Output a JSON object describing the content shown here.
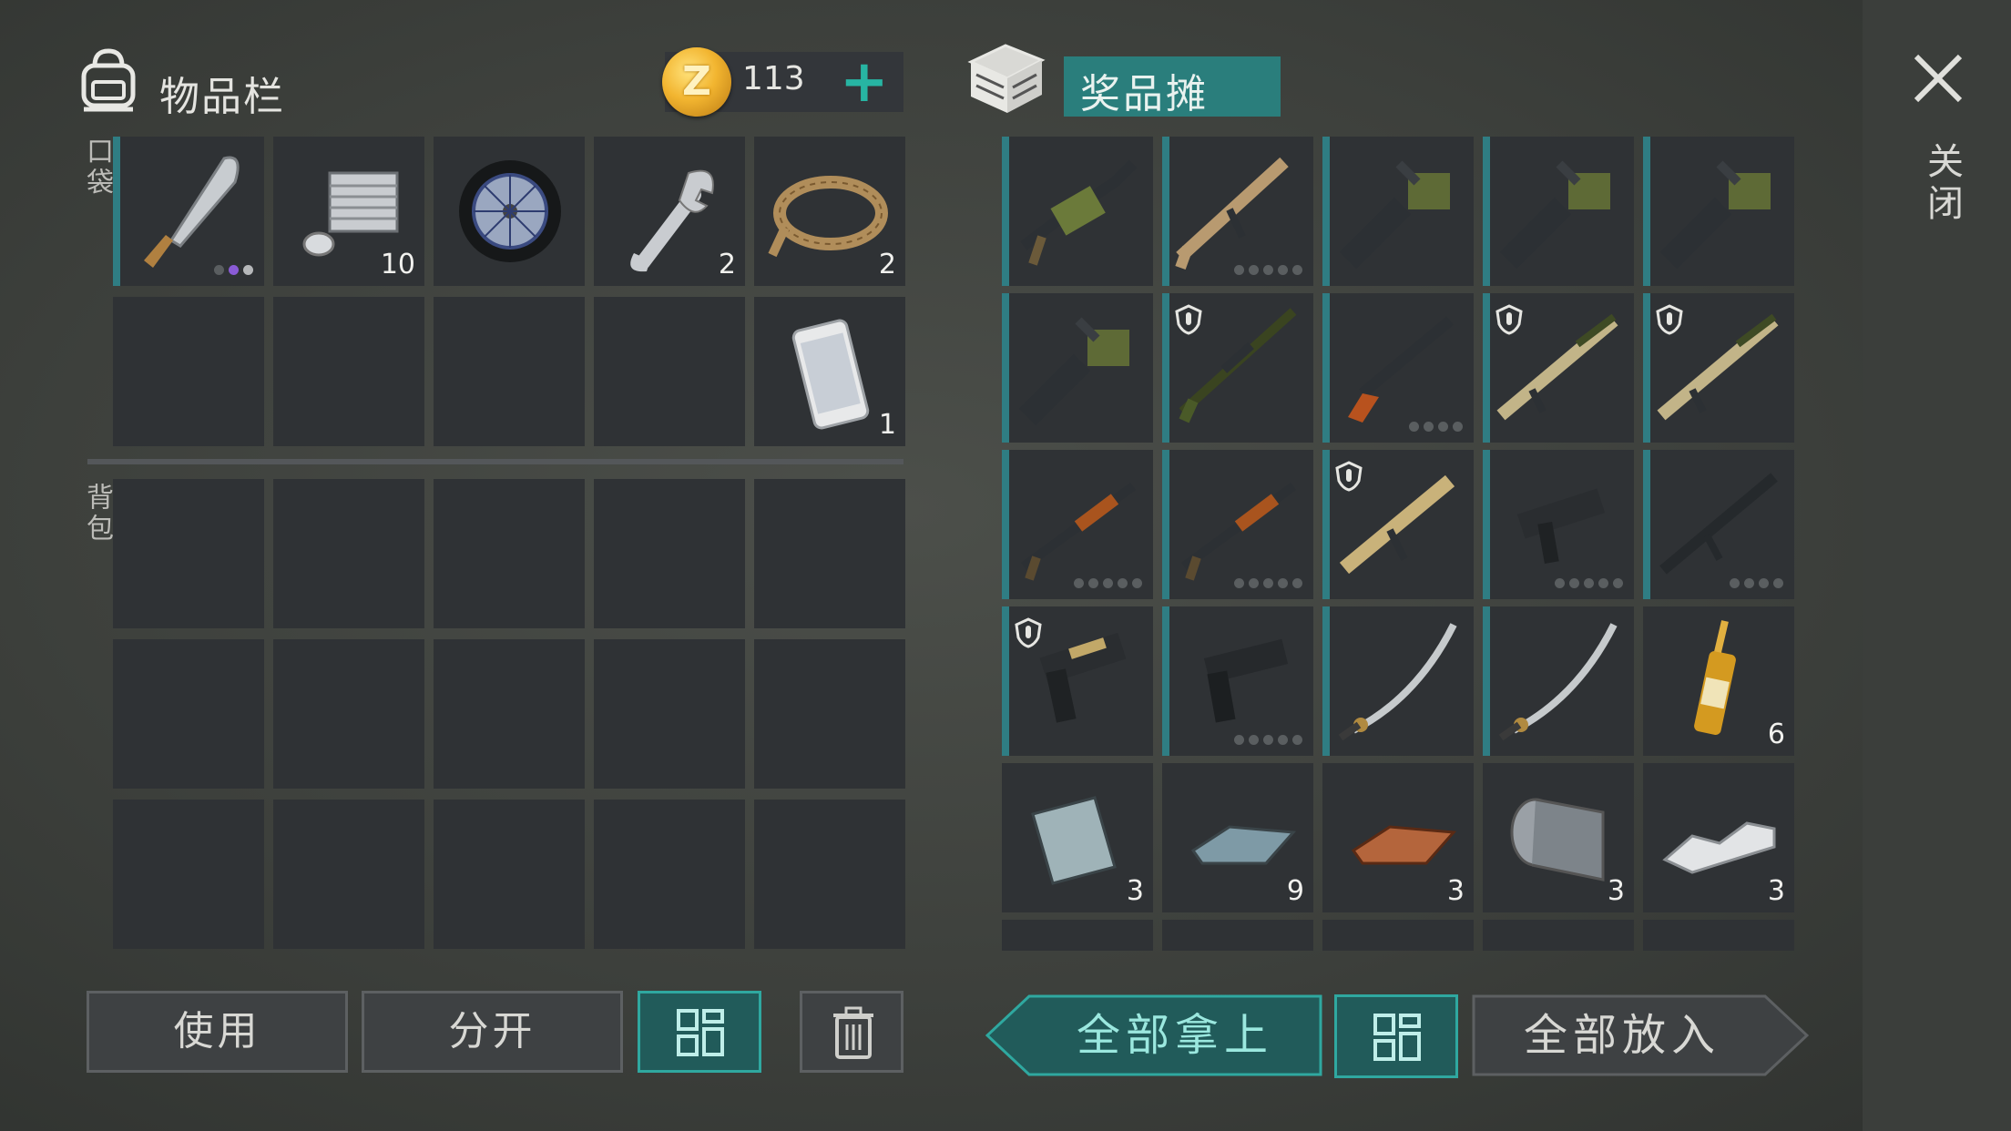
{
  "inventory": {
    "title": "物品栏",
    "coins": "113",
    "pocket_label": "口袋",
    "backpack_label": "背包",
    "pocket": [
      {
        "icon": "machete-icon",
        "count": "",
        "dots": [
          "off",
          "on",
          "w"
        ]
      },
      {
        "icon": "engine-cylinder-icon",
        "count": "10"
      },
      {
        "icon": "wheel-icon",
        "count": ""
      },
      {
        "icon": "wrench-icon",
        "count": "2"
      },
      {
        "icon": "rope-icon",
        "count": "2"
      },
      {
        "icon": "",
        "count": ""
      },
      {
        "icon": "",
        "count": ""
      },
      {
        "icon": "",
        "count": ""
      },
      {
        "icon": "",
        "count": ""
      },
      {
        "icon": "smartphone-icon",
        "count": "1"
      }
    ]
  },
  "loot": {
    "title": "奖品摊",
    "items": [
      {
        "icon": "grenade-launcher-icon",
        "count": ""
      },
      {
        "icon": "scar-rifle-icon",
        "count": "",
        "dots": 5
      },
      {
        "icon": "minigun-icon",
        "count": ""
      },
      {
        "icon": "minigun-icon",
        "count": ""
      },
      {
        "icon": "minigun-icon",
        "count": ""
      },
      {
        "icon": "minigun-icon",
        "count": ""
      },
      {
        "icon": "sniper-rifle-icon",
        "count": "",
        "shield": true
      },
      {
        "icon": "mauser-pistol-icon",
        "count": "",
        "dots": 4
      },
      {
        "icon": "shotgun-camo-icon",
        "count": "",
        "shield": true
      },
      {
        "icon": "shotgun-camo-icon",
        "count": "",
        "shield": true
      },
      {
        "icon": "pump-shotgun-icon",
        "count": "",
        "dots": 5
      },
      {
        "icon": "pump-shotgun-icon",
        "count": "",
        "dots": 5
      },
      {
        "icon": "assault-rifle-camo-icon",
        "count": "",
        "shield": true
      },
      {
        "icon": "uzi-icon",
        "count": "",
        "dots": 5
      },
      {
        "icon": "m16-rifle-icon",
        "count": "",
        "dots": 4
      },
      {
        "icon": "desert-eagle-icon",
        "count": "",
        "shield": true
      },
      {
        "icon": "glock-pistol-icon",
        "count": "",
        "dots": 5
      },
      {
        "icon": "katana-icon",
        "count": ""
      },
      {
        "icon": "katana-icon",
        "count": ""
      },
      {
        "icon": "ampoule-icon",
        "count": "6"
      },
      {
        "icon": "metal-plate-icon",
        "count": "3"
      },
      {
        "icon": "steel-ingot-icon",
        "count": "9"
      },
      {
        "icon": "copper-ingot-icon",
        "count": "3"
      },
      {
        "icon": "sheet-metal-roll-icon",
        "count": "3"
      },
      {
        "icon": "aluminum-bar-icon",
        "count": "3"
      }
    ]
  },
  "buttons": {
    "use": "使用",
    "split": "分开",
    "take_all": "全部拿上",
    "put_all": "全部放入"
  },
  "close_label": "关闭",
  "colors": {
    "accent": "#2fa8a0",
    "slot": "#2f3235",
    "weapon_stripe": "#2f7d83"
  }
}
